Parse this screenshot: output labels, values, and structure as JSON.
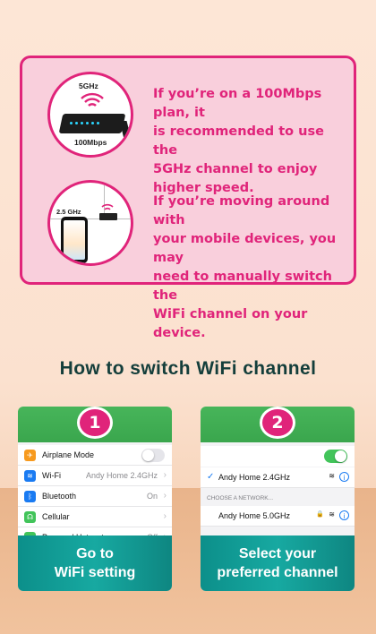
{
  "tips": [
    {
      "text_lines": [
        "If you’re on a 100Mbps plan, it",
        "is recommended to use the",
        "5GHz channel to enjoy",
        "higher speed."
      ],
      "badge_top": "5GHz",
      "badge_bottom": "100Mbps"
    },
    {
      "text_lines": [
        "If you’re moving around with",
        "your mobile devices, you may",
        "need to manually switch the",
        "WiFi channel on your device."
      ],
      "badge_top": "2.5 GHz"
    }
  ],
  "heading": "How to switch WiFi channel",
  "steps": [
    {
      "number": "1",
      "rows": [
        {
          "label": "Airplane Mode",
          "value": "",
          "icon": "airplane-icon",
          "color": "#f79a1e"
        },
        {
          "label": "Wi-Fi",
          "value": "Andy Home 2.4GHz",
          "icon": "wifi-icon",
          "color": "#1a7bf2"
        },
        {
          "label": "Bluetooth",
          "value": "On",
          "icon": "bluetooth-icon",
          "color": "#1a7bf2"
        },
        {
          "label": "Cellular",
          "value": "",
          "icon": "cellular-icon",
          "color": "#42c45a"
        },
        {
          "label": "Personal Hotspot",
          "value": "Off",
          "icon": "hotspot-icon",
          "color": "#42c45a"
        }
      ],
      "footer_lines": [
        "Go to",
        "WiFi setting"
      ]
    },
    {
      "number": "2",
      "connected_network": "Andy Home 2.4GHz",
      "section_label": "CHOOSE A NETWORK...",
      "other_network": "Andy Home 5.0GHz",
      "footer_lines": [
        "Select your",
        "preferred channel"
      ]
    }
  ],
  "colors": {
    "accent_pink": "#e0247a",
    "card_pink": "#f9cfdc",
    "heading_dark": "#143e3b",
    "teal": "#17a9a1",
    "green": "#3aa64d",
    "toggle_on": "#42c45a",
    "ios_blue": "#1a7bf2"
  }
}
